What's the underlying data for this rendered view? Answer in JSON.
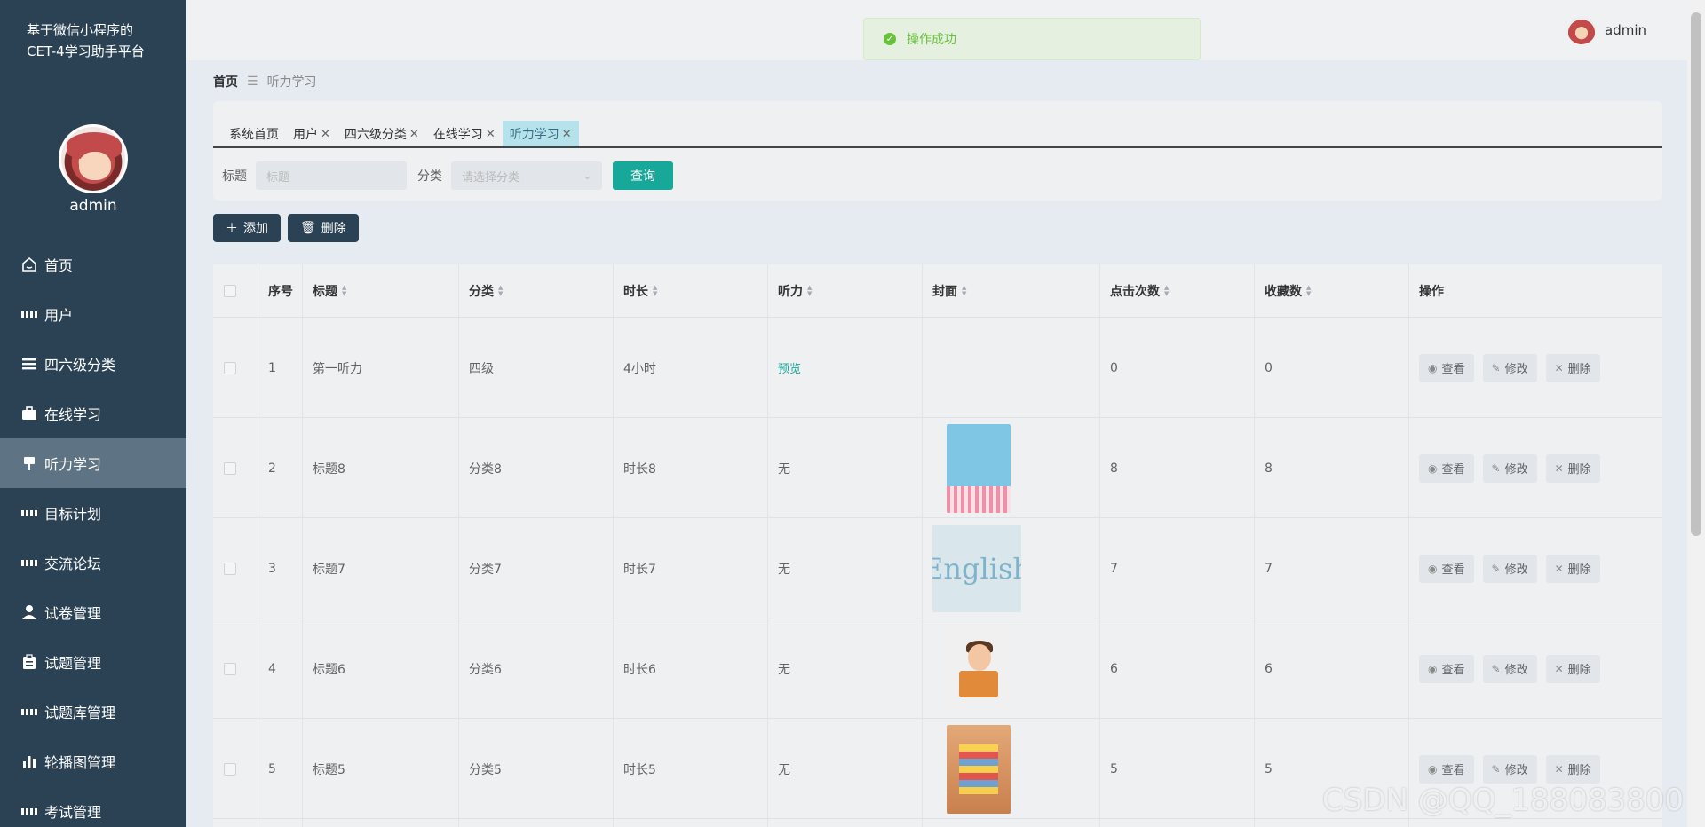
{
  "app": {
    "title_line1": "基于微信小程序的",
    "title_line2": "CET-4学习助手平台"
  },
  "user": {
    "name": "admin"
  },
  "sidebar": {
    "items": [
      {
        "label": "首页",
        "icon": "home-icon"
      },
      {
        "label": "用户",
        "icon": "grid-icon"
      },
      {
        "label": "四六级分类",
        "icon": "list-icon"
      },
      {
        "label": "在线学习",
        "icon": "briefcase-icon"
      },
      {
        "label": "听力学习",
        "icon": "pin-icon",
        "active": true
      },
      {
        "label": "目标计划",
        "icon": "grid-icon"
      },
      {
        "label": "交流论坛",
        "icon": "grid-icon"
      },
      {
        "label": "试卷管理",
        "icon": "person-icon"
      },
      {
        "label": "试题管理",
        "icon": "clipboard-icon"
      },
      {
        "label": "试题库管理",
        "icon": "grid-icon"
      },
      {
        "label": "轮播图管理",
        "icon": "bar-chart-icon"
      },
      {
        "label": "考试管理",
        "icon": "grid-icon"
      }
    ]
  },
  "toast": {
    "text": "操作成功",
    "color": "#67c23a"
  },
  "breadcrumb": {
    "home": "首页",
    "sep": "☰",
    "current": "听力学习"
  },
  "tabs": [
    {
      "label": "系统首页",
      "closable": false
    },
    {
      "label": "用户",
      "closable": true
    },
    {
      "label": "四六级分类",
      "closable": true
    },
    {
      "label": "在线学习",
      "closable": true
    },
    {
      "label": "听力学习",
      "closable": true,
      "active": true
    }
  ],
  "search": {
    "title_label": "标题",
    "title_placeholder": "标题",
    "category_label": "分类",
    "category_placeholder": "请选择分类",
    "query_button": "查询"
  },
  "toolbar": {
    "add_label": "添加",
    "delete_label": "删除"
  },
  "table": {
    "headers": {
      "index": "序号",
      "title": "标题",
      "category": "分类",
      "duration": "时长",
      "listening": "听力",
      "cover": "封面",
      "clicks": "点击次数",
      "favorites": "收藏数",
      "ops": "操作"
    },
    "rows": [
      {
        "index": "1",
        "title": "第一听力",
        "category": "四级",
        "duration": "4小时",
        "listening": "预览",
        "cover": "",
        "clicks": "0",
        "favorites": "0"
      },
      {
        "index": "2",
        "title": "标题8",
        "category": "分类8",
        "duration": "时长8",
        "listening": "无",
        "cover": "cover-a",
        "clicks": "8",
        "favorites": "8"
      },
      {
        "index": "3",
        "title": "标题7",
        "category": "分类7",
        "duration": "时长7",
        "listening": "无",
        "cover": "cover-b",
        "cover_text": "English",
        "clicks": "7",
        "favorites": "7"
      },
      {
        "index": "4",
        "title": "标题6",
        "category": "分类6",
        "duration": "时长6",
        "listening": "无",
        "cover": "cover-c",
        "clicks": "6",
        "favorites": "6"
      },
      {
        "index": "5",
        "title": "标题5",
        "category": "分类5",
        "duration": "时长5",
        "listening": "无",
        "cover": "cover-d",
        "clicks": "5",
        "favorites": "5"
      }
    ],
    "ops": {
      "view": "查看",
      "edit": "修改",
      "delete": "删除"
    }
  },
  "watermark": "CSDN @QQ_188083800",
  "colors": {
    "sidebar_bg": "#2b4254",
    "accent": "#17a89a",
    "active_tab": "#b6e3eb"
  }
}
